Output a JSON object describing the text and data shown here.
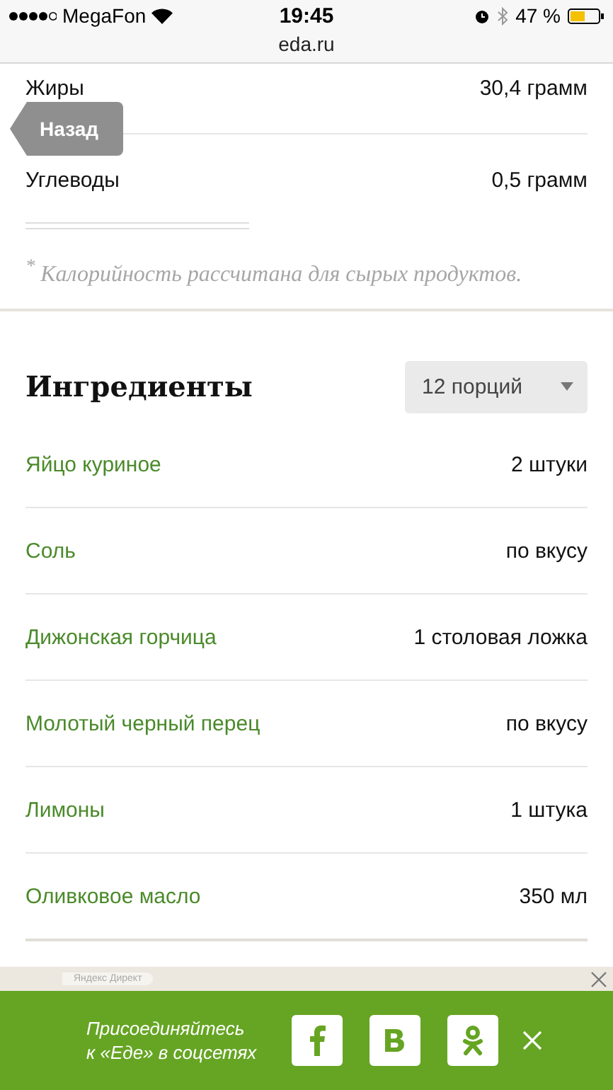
{
  "status_bar": {
    "carrier": "MegaFon",
    "time": "19:45",
    "battery": "47 %"
  },
  "address_bar": {
    "url": "eda.ru"
  },
  "back_button": {
    "label": "Назад"
  },
  "nutrition": [
    {
      "name": "Жиры",
      "value": "30,4 грамм"
    },
    {
      "name": "Углеводы",
      "value": "0,5 грамм"
    }
  ],
  "note": "$^{*}$ Калорийность рассчитана для сырых продуктов.",
  "ingredients": {
    "title": "Ингредиенты",
    "servings": "12 порций",
    "items": [
      {
        "name": "Яйцо куриное",
        "amount": "2 штуки"
      },
      {
        "name": "Соль",
        "amount": "по вкусу"
      },
      {
        "name": "Дижонская горчица",
        "amount": "1 столовая ложка"
      },
      {
        "name": "Молотый черный перец",
        "amount": "по вкусу"
      },
      {
        "name": "Лимоны",
        "amount": "1 штука"
      },
      {
        "name": "Оливковое масло",
        "amount": "350 мл"
      }
    ]
  },
  "ad_strip": {
    "label": "Яндекс Директ"
  },
  "social_banner": {
    "text": "Присоединяйтесь\nк «Еде» в соцсетях",
    "buttons": [
      {
        "kind": "facebook"
      },
      {
        "kind": "vk"
      },
      {
        "kind": "ok"
      }
    ]
  }
}
